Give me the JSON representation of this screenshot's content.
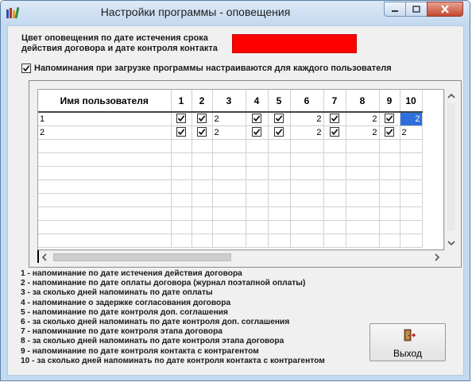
{
  "window": {
    "title": "Настройки программы - оповещения"
  },
  "settings": {
    "color_label_line1": "Цвет оповещения по дате истечения срока",
    "color_label_line2": "действия договора и дате контроля контакта",
    "alert_color": "#ff0000",
    "per_user_checkbox_label": "Напоминания при загрузке программы настраиваются для каждого пользователя",
    "per_user_checked": true
  },
  "grid": {
    "columns": [
      "Имя пользователя",
      "1",
      "2",
      "3",
      "4",
      "5",
      "6",
      "7",
      "8",
      "9",
      "10"
    ],
    "rows": [
      {
        "user": "1",
        "c1": true,
        "c2": true,
        "c3": "2",
        "c4": true,
        "c5": true,
        "c6": "2",
        "c7": true,
        "c8": "2",
        "c9": true,
        "c10": "2"
      },
      {
        "user": "2",
        "c1": true,
        "c2": true,
        "c3": "2",
        "c4": true,
        "c5": true,
        "c6": "2",
        "c7": true,
        "c8": "2",
        "c9": true,
        "c10": "2"
      }
    ]
  },
  "legend": [
    "1 - напоминание по дате истечения действия договора",
    "2 - напоминание по дате оплаты договора (журнал поэтапной оплаты)",
    "3 - за сколько дней напоминать по дате оплаты",
    "4 - напоминание о задержке согласования договора",
    "5 - напоминание по дате контроля доп. соглашения",
    "6 - за сколько дней напоминать по дате контроля доп. соглашения",
    "7 - напоминание по дате контроля этапа договора",
    "8 - за сколько дней напоминать по дате контроля этапа договора",
    "9 - напоминание по дате контроля контакта с контрагентом",
    "10 - за сколько дней напоминать по дате контроля контакта с контрагентом"
  ],
  "exit_button": {
    "label": "Выход",
    "icon": "exit-door-icon"
  }
}
